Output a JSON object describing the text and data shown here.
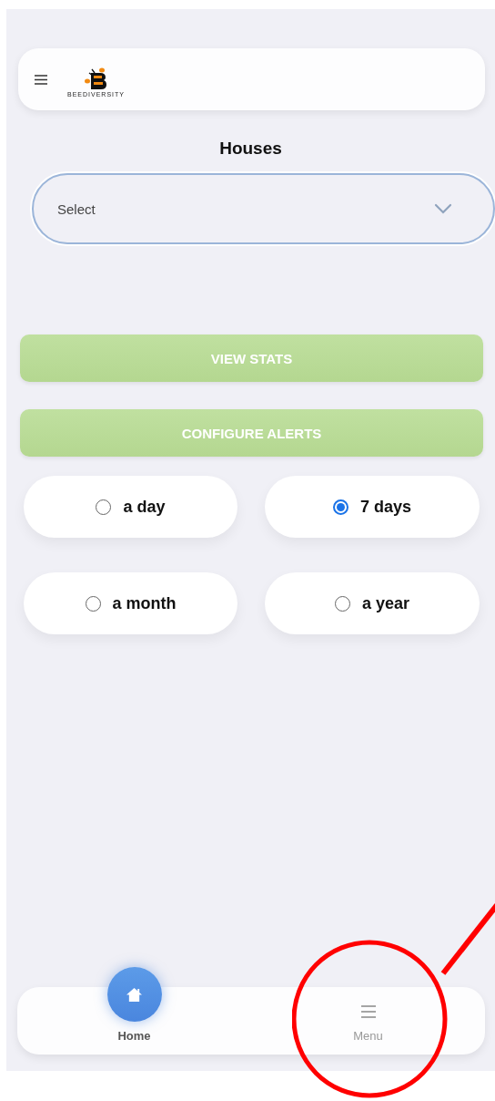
{
  "header": {
    "logo_text": "BEEDIVERSITY"
  },
  "title": "Houses",
  "select": {
    "placeholder": "Select"
  },
  "buttons": [
    "VIEW STATS",
    "CONFIGURE ALERTS"
  ],
  "periods": [
    {
      "label": "a day",
      "selected": false
    },
    {
      "label": "7 days",
      "selected": true
    },
    {
      "label": "a month",
      "selected": false
    },
    {
      "label": "a year",
      "selected": false
    }
  ],
  "bottom_nav": [
    {
      "label": "Home",
      "kind": "home",
      "selected": true
    },
    {
      "label": "Menu",
      "kind": "menu",
      "selected": false
    }
  ]
}
